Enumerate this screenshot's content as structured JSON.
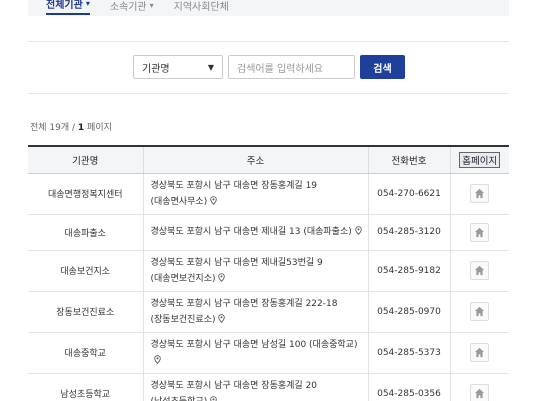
{
  "top_tabs": [
    {
      "label": "전체기관",
      "active": true
    },
    {
      "label": "소속기관",
      "active": false
    },
    {
      "label": "지역사회단체",
      "active": false
    }
  ],
  "search": {
    "select_value": "기관명",
    "input_placeholder": "검색어를 입력하세요",
    "button_label": "검색"
  },
  "count": {
    "prefix": "전체 19개 / ",
    "page": "1",
    "suffix": " 페이지"
  },
  "table": {
    "headers": {
      "name": "기관명",
      "address": "주소",
      "tel": "전화번호",
      "homepage": "홈페이지"
    },
    "rows": [
      {
        "name": "대송면행정복지센터",
        "addr1": "경상북도 포항시 남구 대송면 장동홍계길 19",
        "addr2": "(대송면사무소)",
        "tel": "054-270-6621"
      },
      {
        "name": "대송파출소",
        "addr1": "경상북도 포항시 남구 대송면 제내길 13 (대송파출소)",
        "addr2": "",
        "tel": "054-285-3120"
      },
      {
        "name": "대송보건지소",
        "addr1": "경상북도 포항시 남구 대송면 제내길53번길 9",
        "addr2": "(대송면보건지소)",
        "tel": "054-285-9182"
      },
      {
        "name": "장동보건진료소",
        "addr1": "경상북도 포항시 남구 대송면 장동홍계길 222-18",
        "addr2": "(장동보건진료소)",
        "tel": "054-285-0970"
      },
      {
        "name": "대송중학교",
        "addr1": "경상북도 포항시 남구 대송면 남성길 100 (대송중학교)",
        "addr2": "",
        "tel": "054-285-5373"
      },
      {
        "name": "남성초등학교",
        "addr1": "경상북도 포항시 남구 대송면 장동홍계길 20",
        "addr2": "(남성초등학교)",
        "tel": "054-285-0356"
      }
    ]
  },
  "icons": {
    "map_pin": "map-pin-icon",
    "home": "home-icon"
  },
  "colors": {
    "accent": "#1e3f9c",
    "header_bg": "#f4f5f7"
  }
}
